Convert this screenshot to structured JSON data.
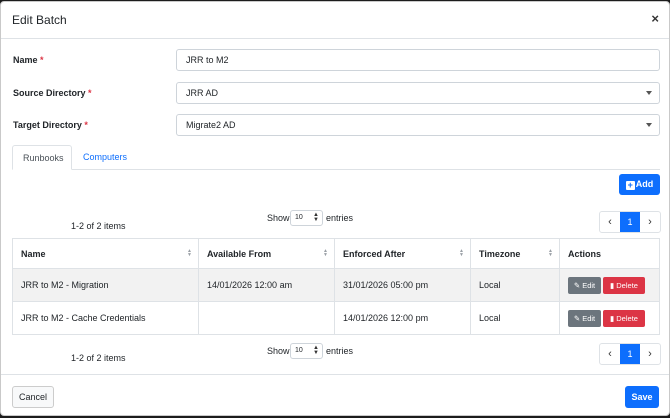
{
  "dialog": {
    "title": "Edit Batch"
  },
  "form": {
    "name_label": "Name",
    "name_value": "JRR to M2",
    "source_label": "Source Directory",
    "source_value": "JRR AD",
    "target_label": "Target Directory",
    "target_value": "Migrate2 AD",
    "required_mark": "*"
  },
  "tabs": [
    {
      "label": "Runbooks",
      "active": true
    },
    {
      "label": "Computers",
      "active": false
    }
  ],
  "toolbar": {
    "add_label": "Add",
    "add_icon": "plus-square-icon"
  },
  "pagination": {
    "items_text": "1-2 of 2 items",
    "show_label": "Show",
    "entries_value": "10",
    "entries_label": "entries",
    "current_page": "1",
    "prev_glyph": "‹",
    "next_glyph": "›"
  },
  "table": {
    "columns": [
      "Name",
      "Available From",
      "Enforced After",
      "Timezone",
      "Actions"
    ],
    "rows": [
      {
        "name": "JRR to M2 - Migration",
        "available_from": "14/01/2026 12:00 am",
        "enforced_after": "31/01/2026 05:00 pm",
        "timezone": "Local"
      },
      {
        "name": "JRR to M2 - Cache Credentials",
        "available_from": "",
        "enforced_after": "14/01/2026 12:00 pm",
        "timezone": "Local"
      }
    ],
    "edit_label": "Edit",
    "delete_label": "Delete"
  },
  "footer": {
    "cancel_label": "Cancel",
    "save_label": "Save"
  },
  "colors": {
    "primary": "#0d6efd",
    "danger": "#dc3545",
    "secondary": "#6c757d"
  }
}
